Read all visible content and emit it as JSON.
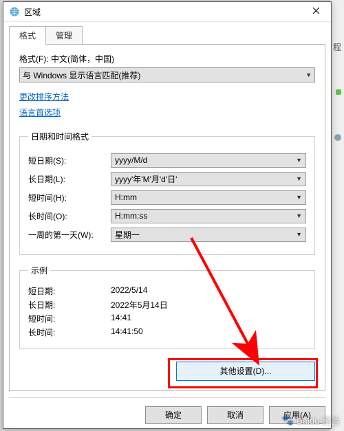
{
  "window": {
    "title": "区域"
  },
  "tabs": {
    "format": "格式",
    "admin": "管理"
  },
  "format": {
    "label": "格式(F): 中文(简体，中国)",
    "select_value": "与 Windows 显示语言匹配(推荐)"
  },
  "links": {
    "sort": "更改排序方法",
    "langpref": "语言首选项"
  },
  "datetime": {
    "legend": "日期和时间格式",
    "short_date_label": "短日期(S):",
    "short_date_value": "yyyy/M/d",
    "long_date_label": "长日期(L):",
    "long_date_value": "yyyy'年'M'月'd'日'",
    "short_time_label": "短时间(H):",
    "short_time_value": "H:mm",
    "long_time_label": "长时间(O):",
    "long_time_value": "H:mm:ss",
    "first_day_label": "一周的第一天(W):",
    "first_day_value": "星期一"
  },
  "examples": {
    "legend": "示例",
    "short_date_label": "短日期:",
    "short_date_value": "2022/5/14",
    "long_date_label": "长日期:",
    "long_date_value": "2022年5月14日",
    "short_time_label": "短时间:",
    "short_time_value": "14:41",
    "long_time_label": "长时间:",
    "long_time_value": "14:41:50"
  },
  "buttons": {
    "additional": "其他设置(D)...",
    "ok": "确定",
    "cancel": "取消",
    "apply": "应用(A)"
  },
  "bg": {
    "label1": "程"
  },
  "watermark": "Baidu 经验"
}
